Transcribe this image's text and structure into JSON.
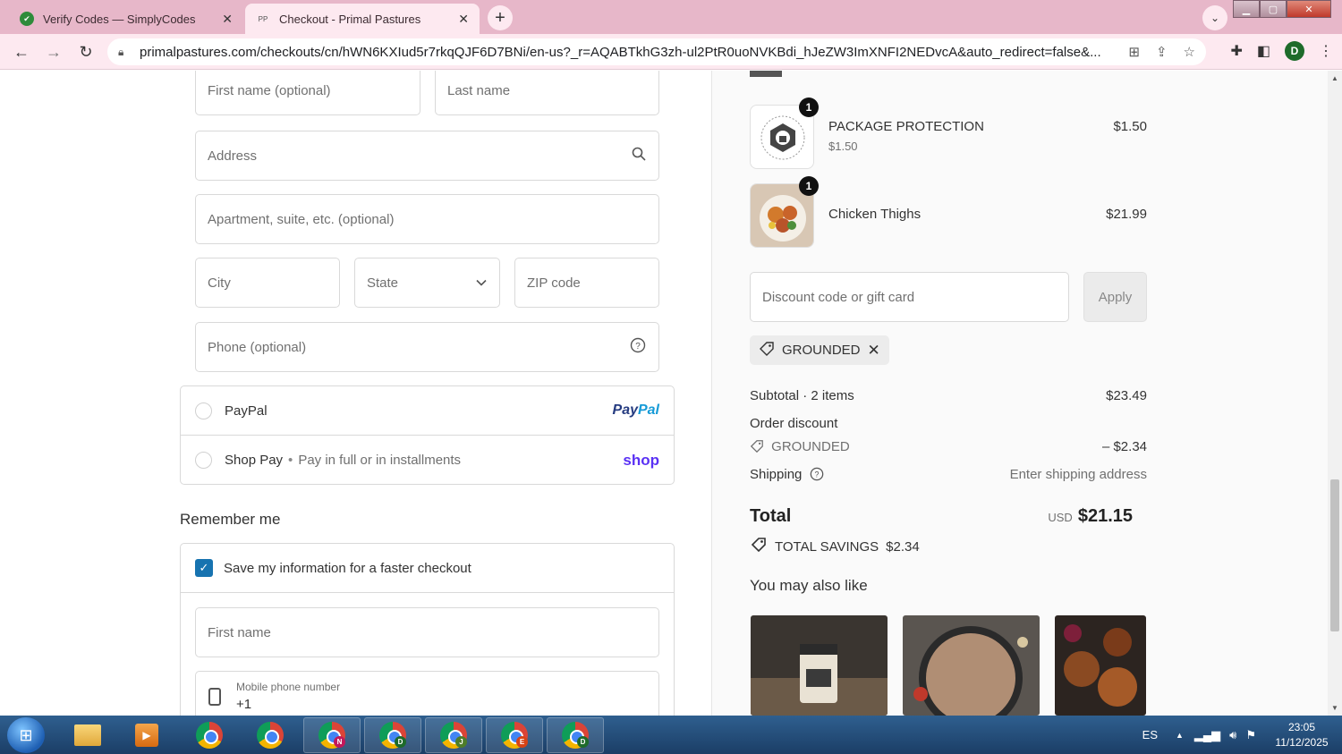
{
  "browser": {
    "tabs": [
      {
        "title": "Verify Codes — SimplyCodes",
        "active": false
      },
      {
        "title": "Checkout - Primal Pastures",
        "active": true
      }
    ],
    "url": "primalpastures.com/checkouts/cn/hWN6KXIud5r7rkqQJF6D7BNi/en-us?_r=AQABTkhG3zh-ul2PtR0uoNVKBdi_hJeZW3ImXNFI2NEDvcA&auto_redirect=false&...",
    "profile_initial": "D"
  },
  "form": {
    "first_name_optional": "First name (optional)",
    "last_name": "Last name",
    "address": "Address",
    "apartment": "Apartment, suite, etc. (optional)",
    "city": "City",
    "state": "State",
    "zip": "ZIP code",
    "phone": "Phone (optional)"
  },
  "payment": {
    "paypal_label": "PayPal",
    "paypal_logo_a": "Pay",
    "paypal_logo_b": "Pal",
    "shoppay_label": "Shop Pay",
    "shoppay_sub": "Pay in full or in installments",
    "shop_logo": "shop"
  },
  "remember": {
    "title": "Remember me",
    "save_label": "Save my information for a faster checkout",
    "first_name": "First name",
    "mobile_label": "Mobile phone number",
    "mobile_value": "+1"
  },
  "summary": {
    "items": [
      {
        "qty": "1",
        "name": "PACKAGE PROTECTION",
        "sub": "$1.50",
        "price": "$1.50"
      },
      {
        "qty": "1",
        "name": "Chicken Thighs",
        "sub": "",
        "price": "$21.99"
      }
    ],
    "discount_placeholder": "Discount code or gift card",
    "apply_label": "Apply",
    "applied_code": "GROUNDED",
    "subtotal_label": "Subtotal · 2 items",
    "subtotal_value": "$23.49",
    "order_discount_label": "Order discount",
    "discount_code_label": "GROUNDED",
    "discount_value": "– $2.34",
    "shipping_label": "Shipping",
    "shipping_value": "Enter shipping address",
    "total_label": "Total",
    "total_currency": "USD",
    "total_value": "$21.15",
    "savings_label": "TOTAL SAVINGS",
    "savings_value": "$2.34",
    "also_like": "You may also like"
  },
  "taskbar": {
    "chrome_badges": [
      "N",
      "D",
      "J",
      "E",
      "D"
    ],
    "lang": "ES",
    "time": "23:05",
    "date": "11/12/2025"
  },
  "colors": {
    "accent": "#1773b0",
    "tab_strip": "#e7b7c9",
    "toolbar": "#fde9f0",
    "shop": "#5a31f4",
    "paypal_dark": "#253b80",
    "paypal_light": "#179bd7"
  }
}
